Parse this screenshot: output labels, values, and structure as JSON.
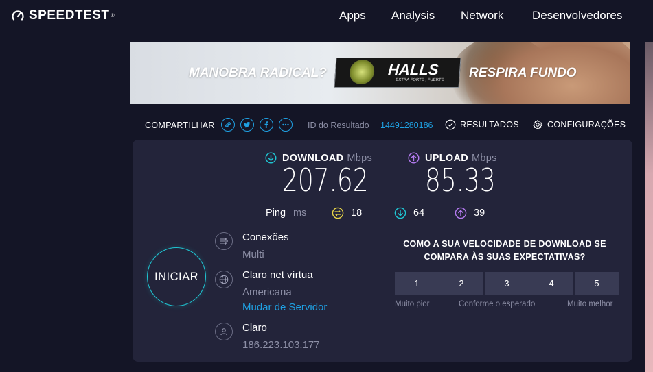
{
  "header": {
    "logo_text": "SPEEDTEST",
    "logo_tm": "®",
    "nav": [
      "Apps",
      "Analysis",
      "Network",
      "Desenvolvedores"
    ]
  },
  "ad": {
    "left_text": "MANOBRA RADICAL?",
    "product": "HALLS",
    "product_sub": "EXTRA FORTE | FUERTE",
    "right_text": "RESPIRA FUNDO"
  },
  "share": {
    "label": "COMPARTILHAR",
    "icons": [
      "link-icon",
      "twitter-icon",
      "facebook-icon",
      "more-icon"
    ],
    "result_id_label": "ID do Resultado",
    "result_id": "14491280186",
    "results_label": "RESULTADOS",
    "settings_label": "CONFIGURAÇÕES"
  },
  "metrics": {
    "download_label": "DOWNLOAD",
    "upload_label": "UPLOAD",
    "unit": "Mbps",
    "download_value": "207.62",
    "upload_value": "85.33",
    "ping_label": "Ping",
    "ping_unit": "ms",
    "ping_idle": "18",
    "ping_download": "64",
    "ping_upload": "39"
  },
  "go_button": "INICIAR",
  "server": {
    "connections_label": "Conexões",
    "connections_value": "Multi",
    "host_name": "Claro net vírtua",
    "host_location": "Americana",
    "change_server": "Mudar de Servidor",
    "isp_name": "Claro",
    "isp_ip": "186.223.103.177"
  },
  "survey": {
    "question": "COMO A SUA VELOCIDADE DE DOWNLOAD SE COMPARA ÀS SUAS EXPECTATIVAS?",
    "ratings": [
      "1",
      "2",
      "3",
      "4",
      "5"
    ],
    "scale_low": "Muito pior",
    "scale_mid": "Conforme o esperado",
    "scale_high": "Muito melhor"
  },
  "colors": {
    "background": "#141526",
    "panel": "#23243a",
    "accent_blue": "#1fa0e2",
    "download_cyan": "#1fc7d4",
    "upload_purple": "#b57bf1",
    "ping_yellow": "#e8d547"
  }
}
